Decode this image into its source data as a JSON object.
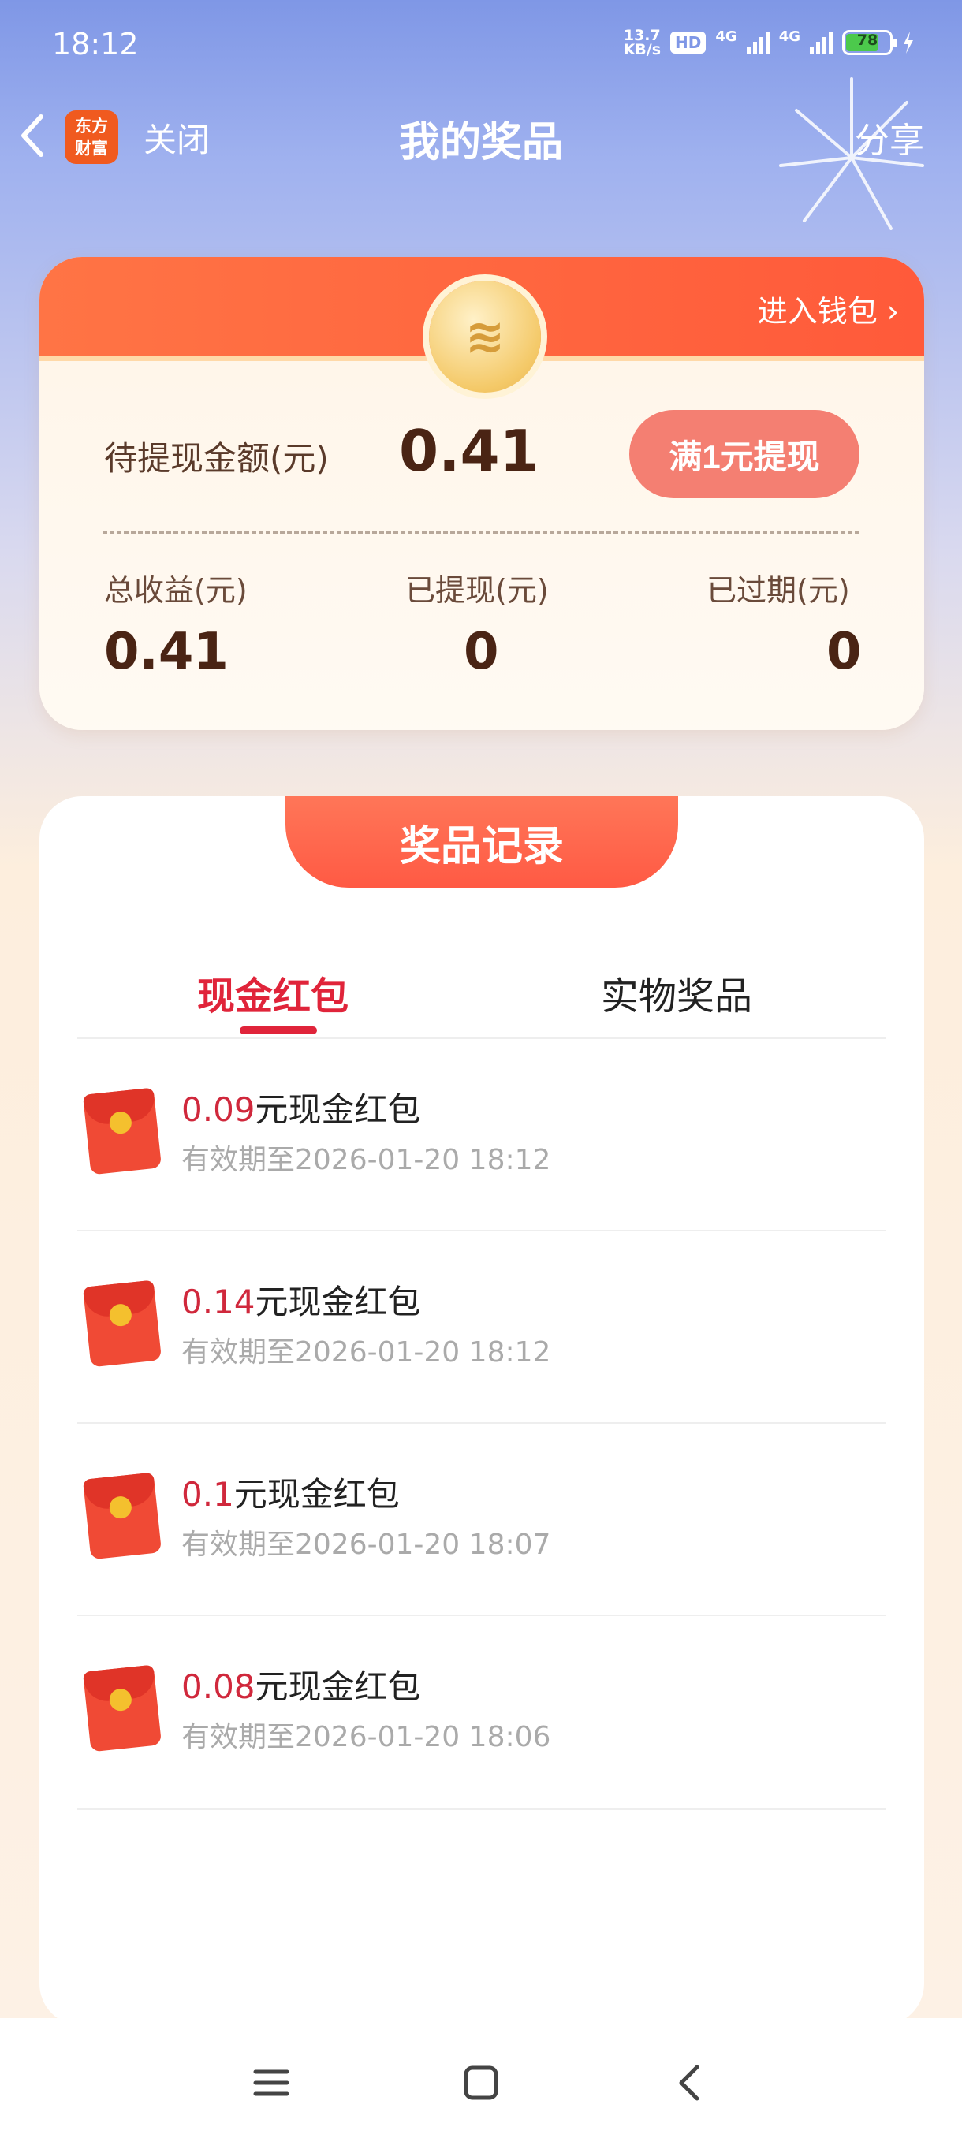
{
  "status": {
    "time": "18:12",
    "net_speed": [
      "13.7",
      "KB/s"
    ],
    "hd": "HD",
    "net1": "4G",
    "net2": "4G",
    "battery": "78"
  },
  "nav": {
    "logo_text": [
      "东方",
      "财富"
    ],
    "close": "关闭",
    "title": "我的奖品",
    "share": "分享"
  },
  "summary": {
    "wallet_link": "进入钱包 ›",
    "pending_label": "待提现金额(元)",
    "pending_value": "0.41",
    "withdraw_button": "满1元提现",
    "stats": [
      {
        "label": "总收益(元)",
        "value": "0.41"
      },
      {
        "label": "已提现(元)",
        "value": "0"
      },
      {
        "label": "已过期(元)",
        "value": "0"
      }
    ]
  },
  "records": {
    "heading": "奖品记录",
    "tabs": [
      {
        "label": "现金红包",
        "active": true
      },
      {
        "label": "实物奖品",
        "active": false
      }
    ],
    "items": [
      {
        "amount": "0.09",
        "suffix": "元现金红包",
        "expiry": "有效期至2026-01-20 18:12"
      },
      {
        "amount": "0.14",
        "suffix": "元现金红包",
        "expiry": "有效期至2026-01-20 18:12"
      },
      {
        "amount": "0.1",
        "suffix": "元现金红包",
        "expiry": "有效期至2026-01-20 18:07"
      },
      {
        "amount": "0.08",
        "suffix": "元现金红包",
        "expiry": "有效期至2026-01-20 18:06"
      }
    ]
  },
  "colors": {
    "accent_red": "#e0243a",
    "banner_orange": "#ff6a45",
    "withdraw_button": "#f47f72"
  },
  "icons": [
    "back-icon",
    "app-logo",
    "coin-icon",
    "red-envelope-icon",
    "menu-icon",
    "home-icon",
    "system-back-icon"
  ]
}
